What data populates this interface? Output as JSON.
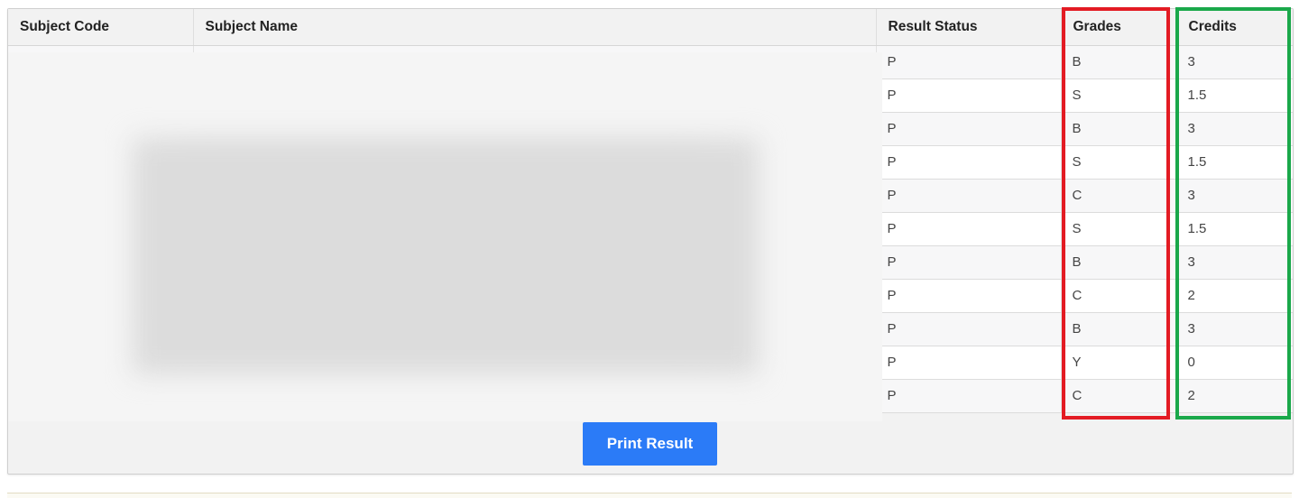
{
  "table": {
    "headers": [
      "Subject Code",
      "Subject Name",
      "Result Status",
      "Grades",
      "Credits"
    ],
    "rows": [
      {
        "status": "P",
        "grade": "B",
        "credits": "3"
      },
      {
        "status": "P",
        "grade": "S",
        "credits": "1.5"
      },
      {
        "status": "P",
        "grade": "B",
        "credits": "3"
      },
      {
        "status": "P",
        "grade": "S",
        "credits": "1.5"
      },
      {
        "status": "P",
        "grade": "C",
        "credits": "3"
      },
      {
        "status": "P",
        "grade": "S",
        "credits": "1.5"
      },
      {
        "status": "P",
        "grade": "B",
        "credits": "3"
      },
      {
        "status": "P",
        "grade": "C",
        "credits": "2"
      },
      {
        "status": "P",
        "grade": "B",
        "credits": "3"
      },
      {
        "status": "P",
        "grade": "Y",
        "credits": "0"
      },
      {
        "status": "P",
        "grade": "C",
        "credits": "2"
      }
    ]
  },
  "actions": {
    "print_label": "Print Result"
  },
  "colors": {
    "grades_highlight": "#e31b23",
    "credits_highlight": "#1aa84a",
    "button": "#2b7bf7"
  }
}
